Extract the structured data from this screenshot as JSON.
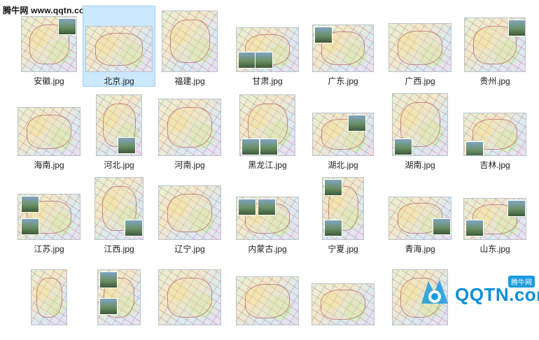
{
  "watermark": "腾牛网 www.qqtn.com",
  "files": [
    {
      "name": "安徽.jpg",
      "selected": false
    },
    {
      "name": "北京.jpg",
      "selected": true
    },
    {
      "name": "福建.jpg",
      "selected": false
    },
    {
      "name": "甘肃.jpg",
      "selected": false
    },
    {
      "name": "广东.jpg",
      "selected": false
    },
    {
      "name": "广西.jpg",
      "selected": false
    },
    {
      "name": "贵州.jpg",
      "selected": false
    },
    {
      "name": "海南.jpg",
      "selected": false
    },
    {
      "name": "河北.jpg",
      "selected": false
    },
    {
      "name": "河南.jpg",
      "selected": false
    },
    {
      "name": "黑龙江.jpg",
      "selected": false
    },
    {
      "name": "湖北.jpg",
      "selected": false
    },
    {
      "name": "湖南.jpg",
      "selected": false
    },
    {
      "name": "吉林.jpg",
      "selected": false
    },
    {
      "name": "江苏.jpg",
      "selected": false
    },
    {
      "name": "江西.jpg",
      "selected": false
    },
    {
      "name": "辽宁.jpg",
      "selected": false
    },
    {
      "name": "内蒙古.jpg",
      "selected": false
    },
    {
      "name": "宁夏.jpg",
      "selected": false
    },
    {
      "name": "青海.jpg",
      "selected": false
    },
    {
      "name": "山东.jpg",
      "selected": false
    },
    {
      "name": "",
      "selected": false
    },
    {
      "name": "",
      "selected": false
    },
    {
      "name": "",
      "selected": false
    },
    {
      "name": "",
      "selected": false
    },
    {
      "name": "",
      "selected": false
    },
    {
      "name": "",
      "selected": false
    }
  ],
  "logo": {
    "text": "QQTN.com",
    "badge": "腾牛网",
    "color": "#0f8fd8"
  }
}
